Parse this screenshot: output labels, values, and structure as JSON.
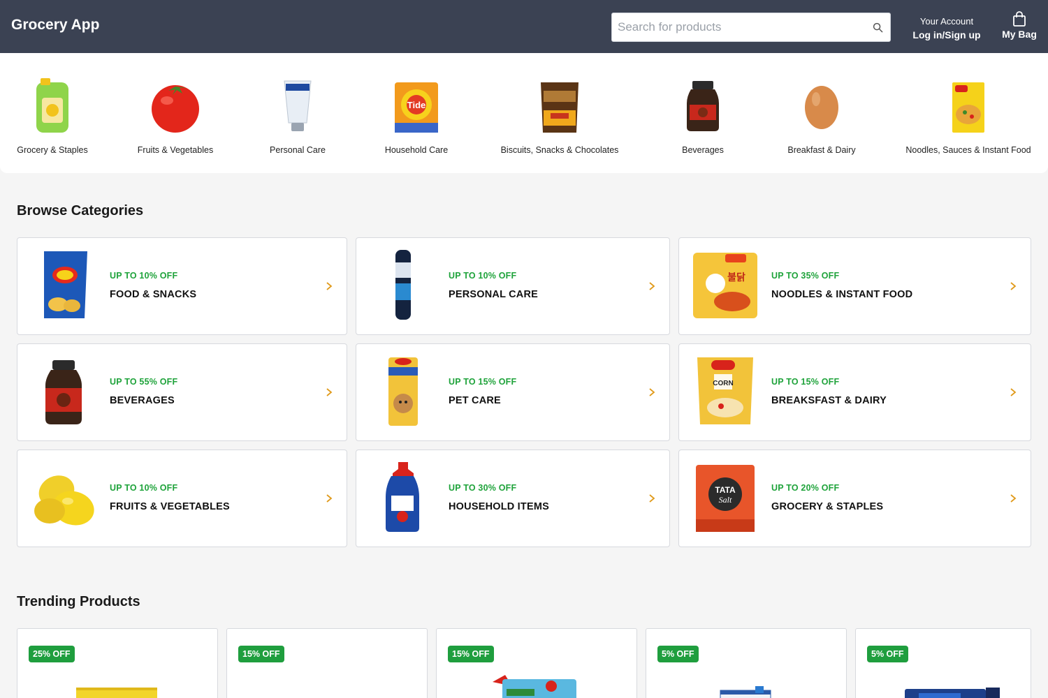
{
  "header": {
    "brand": "Grocery App",
    "search_placeholder": "Search for products",
    "account_line1": "Your Account",
    "account_line2": "Log in/Sign up",
    "bag_label": "My Bag"
  },
  "categories": [
    {
      "label": "Grocery & Staples",
      "icon": "oil-can-icon"
    },
    {
      "label": "Fruits & Vegetables",
      "icon": "tomato-icon"
    },
    {
      "label": "Personal Care",
      "icon": "cream-tube-icon"
    },
    {
      "label": "Household Care",
      "icon": "detergent-pack-icon"
    },
    {
      "label": "Biscuits, Snacks & Chocolates",
      "icon": "snack-pack-icon"
    },
    {
      "label": "Beverages",
      "icon": "coffee-jar-icon"
    },
    {
      "label": "Breakfast & Dairy",
      "icon": "egg-icon"
    },
    {
      "label": "Noodles, Sauces & Instant Food",
      "icon": "noodles-pack-icon"
    }
  ],
  "browse": {
    "title": "Browse Categories",
    "cards": [
      {
        "offer": "UP TO 10% OFF",
        "name": "FOOD & SNACKS",
        "icon": "chips-icon"
      },
      {
        "offer": "UP TO 10% OFF",
        "name": "PERSONAL CARE",
        "icon": "deodorant-icon"
      },
      {
        "offer": "UP TO 35% OFF",
        "name": "NOODLES & INSTANT FOOD",
        "icon": "noodles-icon"
      },
      {
        "offer": "UP TO 55% OFF",
        "name": "BEVERAGES",
        "icon": "coffee-jar-icon"
      },
      {
        "offer": "UP TO 15% OFF",
        "name": "PET CARE",
        "icon": "dog-treat-icon"
      },
      {
        "offer": "UP TO 15% OFF",
        "name": "BREAKSFAST & DAIRY",
        "icon": "cereal-icon"
      },
      {
        "offer": "UP TO 10% OFF",
        "name": "FRUITS & VEGETABLES",
        "icon": "mango-icon"
      },
      {
        "offer": "UP TO 30% OFF",
        "name": "HOUSEHOLD ITEMS",
        "icon": "cleaner-bottle-icon"
      },
      {
        "offer": "UP TO 20% OFF",
        "name": "GROCERY & STAPLES",
        "icon": "salt-pack-icon"
      }
    ]
  },
  "trending": {
    "title": "Trending Products",
    "products": [
      {
        "badge": "25% OFF"
      },
      {
        "badge": "15% OFF"
      },
      {
        "badge": "15% OFF"
      },
      {
        "badge": "5% OFF"
      },
      {
        "badge": "5% OFF"
      }
    ]
  },
  "colors": {
    "header_bg": "#3b4253",
    "offer_green": "#1fa33b",
    "badge_green": "#1f9e3e",
    "chevron": "#e09a1b"
  }
}
